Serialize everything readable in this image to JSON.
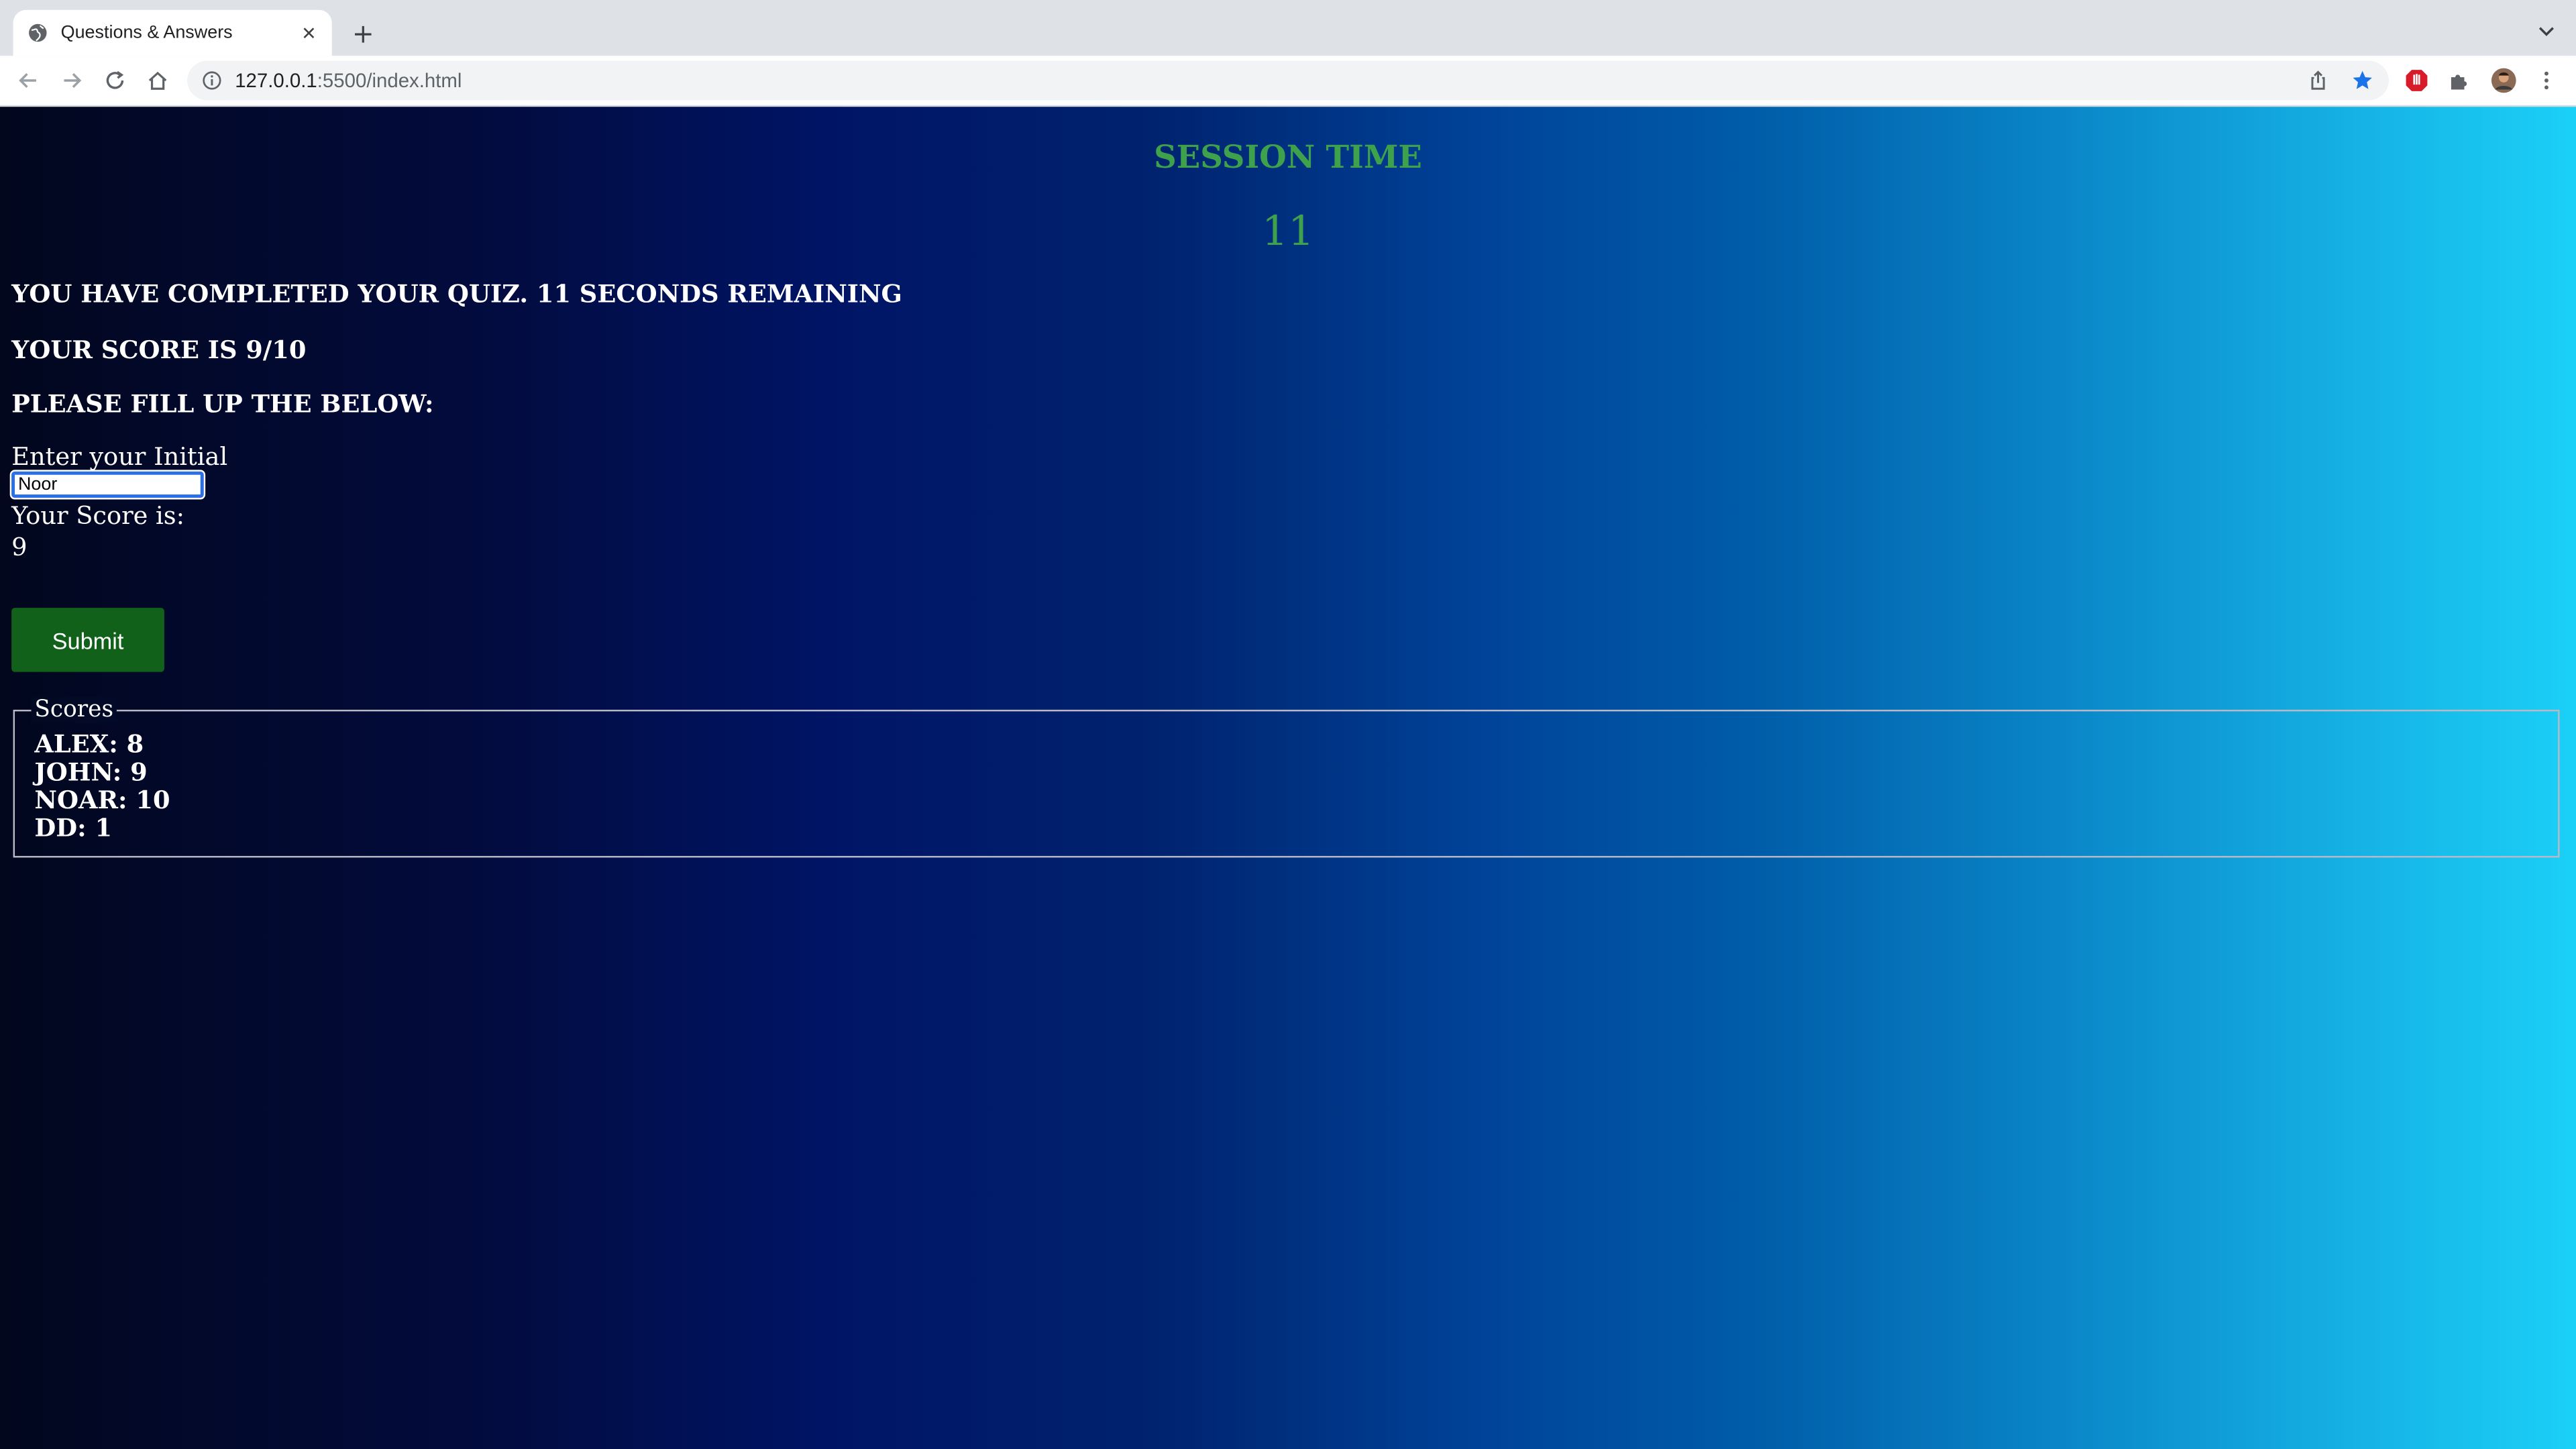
{
  "browser": {
    "tab_title": "Questions & Answers",
    "url_host": "127.0.0.1",
    "url_path": ":5500/index.html"
  },
  "session": {
    "title": "SESSION TIME",
    "time": "11"
  },
  "messages": {
    "completed": "YOU HAVE COMPLETED YOUR QUIZ. 11 SECONDS REMAINING",
    "score": "YOUR SCORE IS 9/10",
    "fill": "PLEASE FILL UP THE BELOW:"
  },
  "form": {
    "initial_label": "Enter your Initial",
    "initial_value": "Noor",
    "score_label": "Your Score is:",
    "score_value": "9",
    "submit_label": "Submit"
  },
  "scores": {
    "legend": "Scores",
    "items": [
      "ALEX: 8",
      "JOHN: 9",
      "NOAR: 10",
      "DD: 1"
    ]
  },
  "colors": {
    "session_green": "#3ea24c",
    "submit_green": "#11611a",
    "input_focus": "#2c6ee6"
  }
}
